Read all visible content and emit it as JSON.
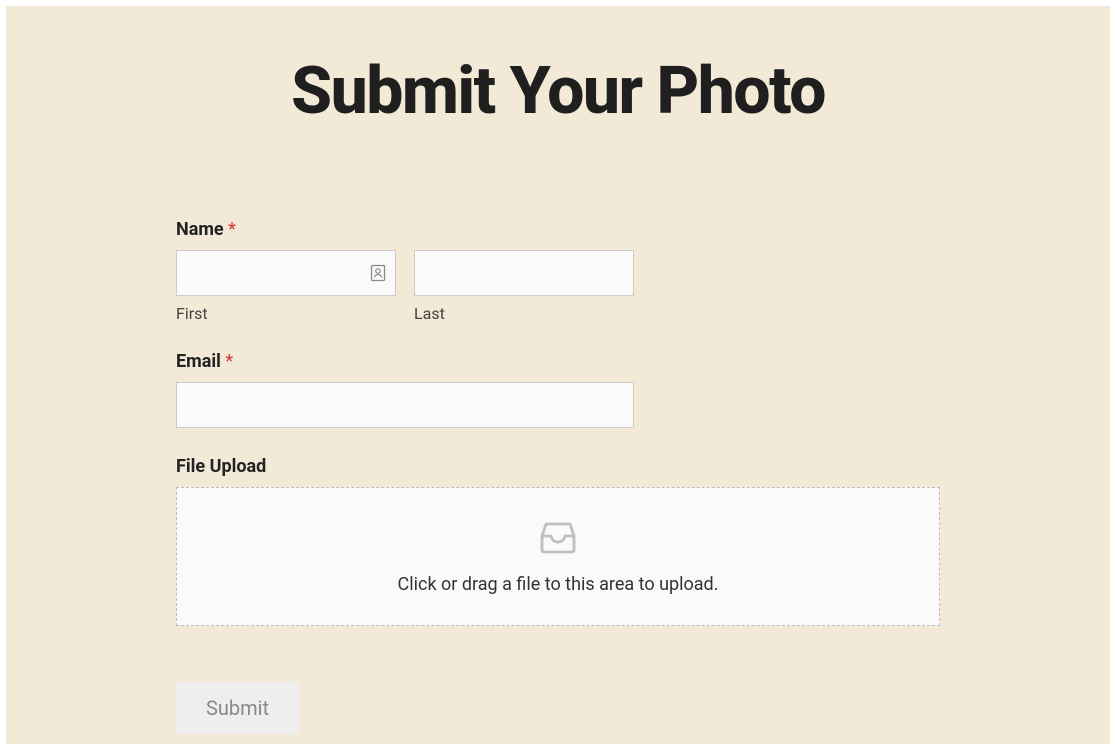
{
  "page": {
    "title": "Submit Your Photo"
  },
  "form": {
    "name": {
      "label": "Name",
      "required_mark": "*",
      "first_sublabel": "First",
      "last_sublabel": "Last",
      "first_value": "",
      "last_value": ""
    },
    "email": {
      "label": "Email",
      "required_mark": "*",
      "value": ""
    },
    "upload": {
      "label": "File Upload",
      "hint": "Click or drag a file to this area to upload."
    },
    "submit": {
      "label": "Submit"
    }
  }
}
